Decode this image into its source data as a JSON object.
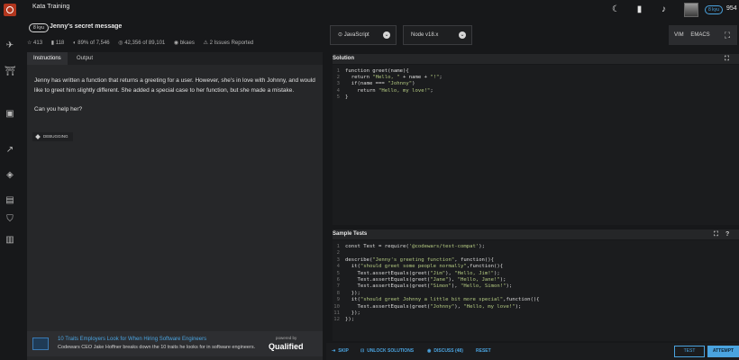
{
  "app": {
    "brand": "Kata Training",
    "honor": "954",
    "rank": "8 kyu"
  },
  "kata": {
    "kyu": "8 kyu",
    "title": "Jenny's secret message",
    "stats": {
      "satisfaction": "413",
      "bookmarks": "118",
      "positive": "89% of 7,546",
      "completions": "42,356 of 89,101",
      "author": "bkaes",
      "issues": "2 Issues Reported"
    }
  },
  "selectors": {
    "language": "JavaScript",
    "runtime": "Node v18.x"
  },
  "keymaps": {
    "vim": "VIM",
    "emacs": "EMACS"
  },
  "tabs": {
    "instructions": "Instructions",
    "output": "Output"
  },
  "description": {
    "p1": "Jenny has written a function that returns a greeting for a user. However, she's in love with Johnny, and would like to greet him slightly different. She added a special case to her function, but she made a mistake.",
    "p2": "Can you help her?"
  },
  "tag": "DEBUGGING",
  "ad": {
    "title": "10 Traits Employers Look for When Hiring Software Engineers",
    "body": "Codewars CEO Jake Hoffner breaks down the 10 traits he looks for in software engineers.",
    "powered_by": "powered by",
    "sponsor": "Qualified"
  },
  "solution": {
    "title": "Solution",
    "lines": [
      {
        "n": "1",
        "text": "function greet(name){"
      },
      {
        "n": "2",
        "text": "  return \"Hello, \" + name + \"!\";"
      },
      {
        "n": "3",
        "text": "  if(name === \"Johnny\")"
      },
      {
        "n": "4",
        "text": "    return \"Hello, my love!\";"
      },
      {
        "n": "5",
        "text": "}"
      }
    ]
  },
  "sample_tests": {
    "title": "Sample Tests",
    "lines": [
      {
        "n": "1",
        "text": "const Test = require('@codewars/test-compat');"
      },
      {
        "n": "2",
        "text": ""
      },
      {
        "n": "3",
        "text": "describe(\"Jenny's greeting function\", function(){"
      },
      {
        "n": "4",
        "text": "  it(\"should greet some people normally\",function(){"
      },
      {
        "n": "5",
        "text": "    Test.assertEquals(greet(\"Jim\"), \"Hello, Jim!\");"
      },
      {
        "n": "6",
        "text": "    Test.assertEquals(greet(\"Jane\"), \"Hello, Jane!\");"
      },
      {
        "n": "7",
        "text": "    Test.assertEquals(greet(\"Simon\"), \"Hello, Simon!\");"
      },
      {
        "n": "8",
        "text": "  });"
      },
      {
        "n": "9",
        "text": "  it(\"should greet Johnny a little bit more special\",function(){"
      },
      {
        "n": "10",
        "text": "    Test.assertEquals(greet(\"Johnny\"), \"Hello, my love!\");"
      },
      {
        "n": "11",
        "text": "  });"
      },
      {
        "n": "12",
        "text": "});"
      }
    ]
  },
  "actions": {
    "skip": "SKIP",
    "unlock": "UNLOCK SOLUTIONS",
    "discuss": "DISCUSS (48)",
    "reset": "RESET",
    "test": "TEST",
    "attempt": "ATTEMPT"
  },
  "colors": {
    "accent": "#4aa3df",
    "brand_red": "#b1361e",
    "background": "#17181a"
  }
}
